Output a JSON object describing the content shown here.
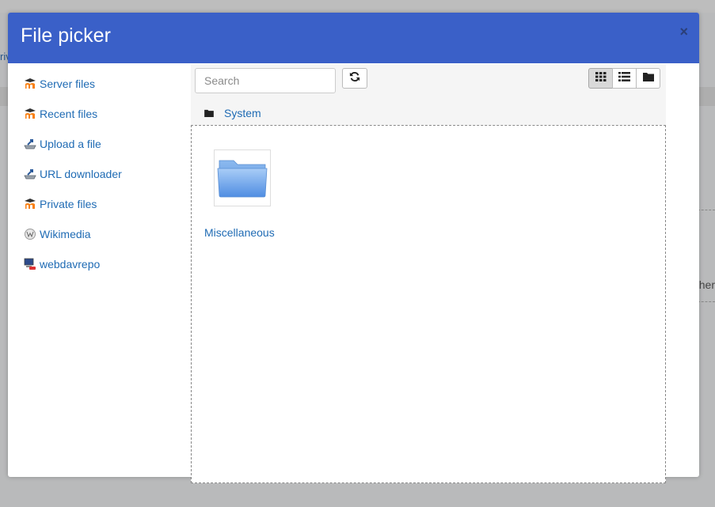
{
  "background": {
    "left_fragment": "riv",
    "right_fragment": "ther"
  },
  "dialog": {
    "title": "File picker",
    "close_label": "×"
  },
  "repositories": [
    {
      "label": "Server files",
      "icon": "moodle-icon"
    },
    {
      "label": "Recent files",
      "icon": "moodle-icon"
    },
    {
      "label": "Upload a file",
      "icon": "upload-icon"
    },
    {
      "label": "URL downloader",
      "icon": "url-download-icon"
    },
    {
      "label": "Private files",
      "icon": "moodle-icon"
    },
    {
      "label": "Wikimedia",
      "icon": "wikimedia-icon"
    },
    {
      "label": "webdavrepo",
      "icon": "webdav-icon"
    }
  ],
  "toolbar": {
    "search_placeholder": "Search",
    "search_value": "",
    "view_modes": [
      "icons",
      "list",
      "tree"
    ],
    "active_view": "icons"
  },
  "path": {
    "current": "System"
  },
  "files": [
    {
      "name": "Miscellaneous",
      "type": "folder"
    }
  ],
  "colors": {
    "header": "#3a60c8",
    "link": "#1f6bb4",
    "moodle_orange": "#f98012"
  }
}
